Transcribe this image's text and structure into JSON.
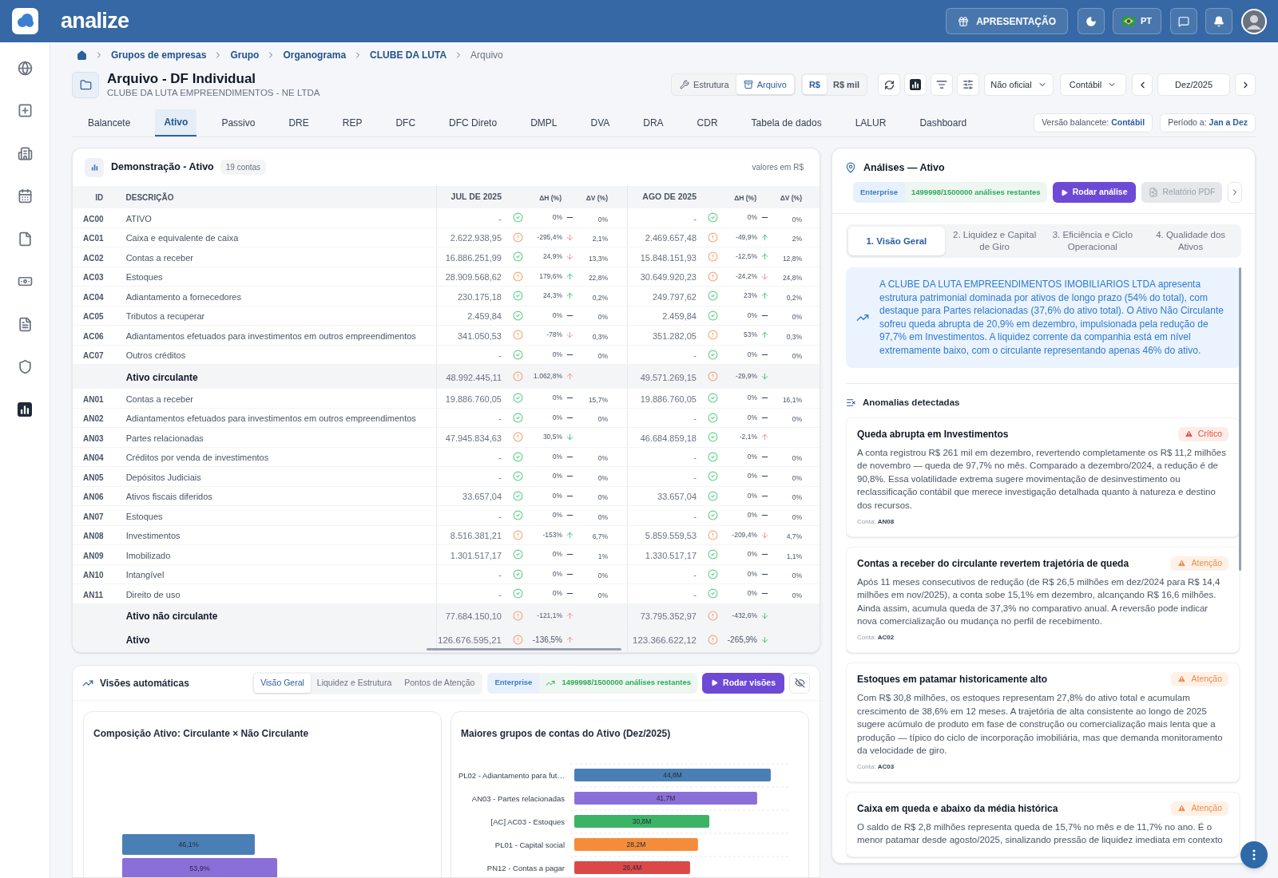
{
  "header": {
    "brand": "analize",
    "presentation_button": "APRESENTAÇÃO",
    "language": "PT"
  },
  "breadcrumb": [
    {
      "label": "Grupos de empresas",
      "current": false
    },
    {
      "label": "Grupo",
      "current": false
    },
    {
      "label": "Organograma",
      "current": false
    },
    {
      "label": "CLUBE DA LUTA",
      "current": false
    },
    {
      "label": "Arquivo",
      "current": true
    }
  ],
  "page": {
    "title": "Arquivo - DF Individual",
    "subtitle": "CLUBE DA LUTA EMPREENDIMENTOS - NE LTDA"
  },
  "toolbar": {
    "view_modes": [
      {
        "label": "Estrutura",
        "selected": false
      },
      {
        "label": "Arquivo",
        "selected": true
      }
    ],
    "units": [
      {
        "label": "R$",
        "selected": true
      },
      {
        "label": "R$ mil",
        "selected": false
      }
    ],
    "status_filter": "Não oficial",
    "basis": "Contábil",
    "period": "Dez/2025"
  },
  "tabs": [
    {
      "label": "Balancete",
      "selected": false
    },
    {
      "label": "Ativo",
      "selected": true
    },
    {
      "label": "Passivo",
      "selected": false
    },
    {
      "label": "DRE",
      "selected": false
    },
    {
      "label": "REP",
      "selected": false
    },
    {
      "label": "DFC",
      "selected": false
    },
    {
      "label": "DFC Direto",
      "selected": false
    },
    {
      "label": "DMPL",
      "selected": false
    },
    {
      "label": "DVA",
      "selected": false
    },
    {
      "label": "DRA",
      "selected": false
    },
    {
      "label": "CDR",
      "selected": false
    },
    {
      "label": "Tabela de dados",
      "selected": false
    },
    {
      "label": "LALUR",
      "selected": false
    },
    {
      "label": "Dashboard",
      "selected": false
    }
  ],
  "chips": [
    "Versão balancete: **Contábil**",
    "Período a: **Jan a Dez**"
  ],
  "statement": {
    "title": "Demonstração - Ativo",
    "count": "19 contas",
    "note": "valores em R$",
    "columns": {
      "id": "ID",
      "description": "DESCRIÇÃO",
      "periods": [
        {
          "label": "JUL DE 2025",
          "change": "ΔH (%)",
          "share": "ΔV (%)"
        },
        {
          "label": "AGO DE 2025",
          "change": "ΔH (%)",
          "share": "ΔV (%)"
        }
      ]
    },
    "rows": [
      {
        "kind": "account",
        "id": "AC00",
        "description": "ATIVO",
        "periods": [
          {
            "value": "-",
            "alert": false,
            "change": "0%",
            "rising": false,
            "falling": false,
            "share": "0%"
          },
          {
            "value": "-",
            "alert": false,
            "change": "0%",
            "rising": false,
            "falling": false,
            "share": "0%"
          }
        ]
      },
      {
        "kind": "account",
        "id": "AC01",
        "description": "Caixa e equivalente de caixa",
        "periods": [
          {
            "value": "2.622.938,95",
            "alert": true,
            "change": "-295,4%",
            "rising": false,
            "falling": true,
            "favorable": false,
            "share": "2,1%"
          },
          {
            "value": "2.469.657,48",
            "alert": true,
            "change": "-49,9%",
            "rising": true,
            "falling": false,
            "favorable": true,
            "share": "2%"
          }
        ]
      },
      {
        "kind": "account",
        "id": "AC02",
        "description": "Contas a receber",
        "periods": [
          {
            "value": "16.886.251,99",
            "alert": false,
            "change": "24,9%",
            "rising": false,
            "falling": true,
            "favorable": false,
            "share": "13,3%"
          },
          {
            "value": "15.848.151,93",
            "alert": true,
            "change": "-12,5%",
            "rising": true,
            "falling": false,
            "favorable": true,
            "share": "12,8%"
          }
        ]
      },
      {
        "kind": "account",
        "id": "AC03",
        "description": "Estoques",
        "periods": [
          {
            "value": "28.909.568,62",
            "alert": true,
            "change": "179,6%",
            "rising": true,
            "falling": false,
            "favorable": true,
            "share": "22,8%"
          },
          {
            "value": "30.649.920,23",
            "alert": true,
            "change": "-24,2%",
            "rising": false,
            "falling": true,
            "favorable": false,
            "share": "24,8%"
          }
        ]
      },
      {
        "kind": "account",
        "id": "AC04",
        "description": "Adiantamento a fornecedores",
        "periods": [
          {
            "value": "230.175,18",
            "alert": false,
            "change": "24,3%",
            "rising": true,
            "falling": false,
            "favorable": true,
            "share": "0,2%"
          },
          {
            "value": "249.797,62",
            "alert": false,
            "change": "23%",
            "rising": true,
            "falling": false,
            "favorable": true,
            "share": "0,2%"
          }
        ]
      },
      {
        "kind": "account",
        "id": "AC05",
        "description": "Tributos a recuperar",
        "periods": [
          {
            "value": "2.459,84",
            "alert": false,
            "change": "0%",
            "rising": false,
            "falling": false,
            "share": "0%"
          },
          {
            "value": "2.459,84",
            "alert": false,
            "change": "0%",
            "rising": false,
            "falling": false,
            "share": "0%"
          }
        ]
      },
      {
        "kind": "account",
        "id": "AC06",
        "description": "Adiantamentos efetuados para investimentos em outros empreendimentos",
        "periods": [
          {
            "value": "341.050,53",
            "alert": true,
            "change": "-78%",
            "rising": false,
            "falling": true,
            "favorable": false,
            "share": "0,3%"
          },
          {
            "value": "351.282,05",
            "alert": true,
            "change": "53%",
            "rising": true,
            "falling": false,
            "favorable": true,
            "share": "0,3%"
          }
        ]
      },
      {
        "kind": "account",
        "id": "AC07",
        "description": "Outros créditos",
        "periods": [
          {
            "value": "-",
            "alert": false,
            "change": "0%",
            "rising": false,
            "falling": false,
            "share": "0%"
          },
          {
            "value": "-",
            "alert": false,
            "change": "0%",
            "rising": false,
            "falling": false,
            "share": "0%"
          }
        ]
      },
      {
        "kind": "subtotal",
        "description": "Ativo circulante",
        "periods": [
          {
            "value": "48.992.445,11",
            "alert": true,
            "change": "1.062,8%",
            "rising": true,
            "falling": false,
            "favorable": false
          },
          {
            "value": "49.571.269,15",
            "alert": true,
            "change": "-29,9%",
            "rising": false,
            "falling": true,
            "favorable": true
          }
        ]
      },
      {
        "kind": "account",
        "id": "AN01",
        "description": "Contas a receber",
        "periods": [
          {
            "value": "19.886.760,05",
            "alert": false,
            "change": "0%",
            "rising": false,
            "falling": false,
            "share": "15,7%"
          },
          {
            "value": "19.886.760,05",
            "alert": false,
            "change": "0%",
            "rising": false,
            "falling": false,
            "share": "16,1%"
          }
        ]
      },
      {
        "kind": "account",
        "id": "AN02",
        "description": "Adiantamentos efetuados para investimentos em outros empreendimentos",
        "periods": [
          {
            "value": "-",
            "alert": false,
            "change": "0%",
            "rising": false,
            "falling": false,
            "share": "0%"
          },
          {
            "value": "-",
            "alert": false,
            "change": "0%",
            "rising": false,
            "falling": false,
            "share": "0%"
          }
        ]
      },
      {
        "kind": "account",
        "id": "AN03",
        "description": "Partes relacionadas",
        "periods": [
          {
            "value": "47.945.834,63",
            "alert": true,
            "change": "30,5%",
            "rising": false,
            "falling": true,
            "favorable": true
          },
          {
            "value": "46.684.859,18",
            "alert": false,
            "change": "-2,1%",
            "rising": true,
            "falling": false,
            "favorable": false
          }
        ]
      },
      {
        "kind": "account",
        "id": "AN04",
        "description": "Créditos por venda de investimentos",
        "periods": [
          {
            "value": "-",
            "alert": false,
            "change": "0%",
            "rising": false,
            "falling": false,
            "share": "0%"
          },
          {
            "value": "-",
            "alert": false,
            "change": "0%",
            "rising": false,
            "falling": false,
            "share": "0%"
          }
        ]
      },
      {
        "kind": "account",
        "id": "AN05",
        "description": "Depósitos Judiciais",
        "periods": [
          {
            "value": "-",
            "alert": false,
            "change": "0%",
            "rising": false,
            "falling": false,
            "share": "0%"
          },
          {
            "value": "-",
            "alert": false,
            "change": "0%",
            "rising": false,
            "falling": false,
            "share": "0%"
          }
        ]
      },
      {
        "kind": "account",
        "id": "AN06",
        "description": "Ativos fiscais diferidos",
        "periods": [
          {
            "value": "33.657,04",
            "alert": false,
            "change": "0%",
            "rising": false,
            "falling": false,
            "share": "0%"
          },
          {
            "value": "33.657,04",
            "alert": false,
            "change": "0%",
            "rising": false,
            "falling": false,
            "share": "0%"
          }
        ]
      },
      {
        "kind": "account",
        "id": "AN07",
        "description": "Estoques",
        "periods": [
          {
            "value": "-",
            "alert": false,
            "change": "0%",
            "rising": false,
            "falling": false,
            "share": "0%"
          },
          {
            "value": "-",
            "alert": false,
            "change": "0%",
            "rising": false,
            "falling": false,
            "share": "0%"
          }
        ]
      },
      {
        "kind": "account",
        "id": "AN08",
        "description": "Investimentos",
        "periods": [
          {
            "value": "8.516.381,21",
            "alert": true,
            "change": "-153%",
            "rising": true,
            "falling": false,
            "favorable": true,
            "share": "6,7%"
          },
          {
            "value": "5.859.559,53",
            "alert": true,
            "change": "-209,4%",
            "rising": false,
            "falling": true,
            "favorable": false,
            "share": "4,7%"
          }
        ]
      },
      {
        "kind": "account",
        "id": "AN09",
        "description": "Imobilizado",
        "periods": [
          {
            "value": "1.301.517,17",
            "alert": false,
            "change": "0%",
            "rising": false,
            "falling": false,
            "share": "1%"
          },
          {
            "value": "1.330.517,17",
            "alert": false,
            "change": "0%",
            "rising": false,
            "falling": false,
            "share": "1,1%"
          }
        ]
      },
      {
        "kind": "account",
        "id": "AN10",
        "description": "Intangível",
        "periods": [
          {
            "value": "-",
            "alert": false,
            "change": "0%",
            "rising": false,
            "falling": false,
            "share": "0%"
          },
          {
            "value": "-",
            "alert": false,
            "change": "0%",
            "rising": false,
            "falling": false,
            "share": "0%"
          }
        ]
      },
      {
        "kind": "account",
        "id": "AN11",
        "description": "Direito de uso",
        "periods": [
          {
            "value": "-",
            "alert": false,
            "change": "0%",
            "rising": false,
            "falling": false,
            "share": "0%"
          },
          {
            "value": "-",
            "alert": false,
            "change": "0%",
            "rising": false,
            "falling": false,
            "share": "0%"
          }
        ]
      },
      {
        "kind": "subtotal",
        "description": "Ativo não circulante",
        "periods": [
          {
            "value": "77.684.150,10",
            "alert": true,
            "change": "-121,1%",
            "rising": true,
            "falling": false,
            "favorable": false
          },
          {
            "value": "73.795.352,97",
            "alert": true,
            "change": "-432,6%",
            "rising": false,
            "falling": true,
            "favorable": true
          }
        ]
      },
      {
        "kind": "total",
        "description": "Ativo",
        "periods": [
          {
            "value": "126.676.595,21",
            "alert": true,
            "change": "-136,5%",
            "rising": true,
            "falling": false,
            "favorable": false
          },
          {
            "value": "123.366.622,12",
            "alert": true,
            "change": "-265,9%",
            "rising": false,
            "falling": true,
            "favorable": true
          }
        ]
      }
    ]
  },
  "auto_views": {
    "title": "Visões automáticas",
    "tabs": [
      {
        "label": "Visão Geral",
        "selected": true
      },
      {
        "label": "Liquidez e Estrutura",
        "selected": false
      },
      {
        "label": "Pontos de Atenção",
        "selected": false
      }
    ],
    "plan": "Enterprise",
    "quota": "1499998/1500000 análises restantes",
    "run_button": "Rodar visões",
    "charts": [
      {
        "title": "Composição Ativo: Circulante × Não Circulante",
        "chart_data": {
          "type": "bar",
          "orientation": "horizontal",
          "values": [
            46.1,
            53.9
          ],
          "value_labels": [
            "46,1%",
            "53,9%"
          ],
          "colors": [
            "#4a7fb5",
            "#8b6fd8"
          ]
        }
      },
      {
        "title": "Maiores grupos de contas do Ativo (Dez/2025)",
        "chart_data": {
          "type": "bar",
          "orientation": "horizontal",
          "categories": [
            "PL02 - Adiantamento para fut…",
            "AN03 - Partes relacionadas",
            "[AC] AC03 - Estoques",
            "PL01 - Capital social",
            "PN12 - Contas a pagar"
          ],
          "values": [
            44.8,
            41.7,
            30.8,
            28.2,
            26.4
          ],
          "value_labels": [
            "44,8M",
            "41,7M",
            "30,8M",
            "28,2M",
            "26,4M"
          ],
          "colors": [
            "#4a7fb5",
            "#8b6fd8",
            "#3cb465",
            "#f48c3a",
            "#dc4848"
          ]
        }
      }
    ]
  },
  "analyses": {
    "title": "Análises — Ativo",
    "plan": "Enterprise",
    "quota": "1499998/1500000 análises restantes",
    "run_button": "Rodar análise",
    "pdf_button": {
      "label": "Relatório PDF",
      "disabled": true
    },
    "tabs": [
      {
        "label": "1. Visão Geral",
        "selected": true
      },
      {
        "label": "2. Liquidez e Capital de Giro",
        "selected": false
      },
      {
        "label": "3. Eficiência e Ciclo Operacional",
        "selected": false
      },
      {
        "label": "4. Qualidade dos Ativos",
        "selected": false
      }
    ],
    "summary": "A CLUBE DA LUTA EMPREENDIMENTOS IMOBILIARIOS LTDA apresenta estrutura patrimonial dominada por ativos de longo prazo (54% do total), com destaque para Partes relacionadas (37,6% do ativo total). O Ativo Não Circulante sofreu queda abrupta de 20,9% em dezembro, impulsionada pela redução de 97,7% em Investimentos. A liquidez corrente da companhia está em nível extremamente baixo, com o circulante representando apenas 46% do ativo.",
    "anomalies_title": "Anomalias detectadas",
    "anomalies": [
      {
        "title": "Queda abrupta em Investimentos",
        "critical": true,
        "severity_label": "Crítico",
        "text": "A conta registrou R$ 261 mil em dezembro, revertendo completamente os R$ 11,2 milhões de novembro — queda de 97,7% no mês. Comparado a dezembro/2024, a redução é de 90,8%. Essa volatilidade extrema sugere movimentação de desinvestimento ou reclassificação contábil que merece investigação detalhada quanto à natureza e destino dos recursos.",
        "account": "Conta: **AN08**"
      },
      {
        "title": "Contas a receber do circulante revertem trajetória de queda",
        "critical": false,
        "severity_label": "Atenção",
        "text": "Após 11 meses consecutivos de redução (de R$ 26,5 milhões em dez/2024 para R$ 14,4 milhões em nov/2025), a conta sobe 15,1% em dezembro, alcançando R$ 16,6 milhões. Ainda assim, acumula queda de 37,3% no comparativo anual. A reversão pode indicar nova comercialização ou mudança no perfil de recebimento.",
        "account": "Conta: **AC02**"
      },
      {
        "title": "Estoques em patamar historicamente alto",
        "critical": false,
        "severity_label": "Atenção",
        "text": "Com R$ 30,8 milhões, os estoques representam 27,8% do ativo total e acumulam crescimento de 38,6% em 12 meses. A trajetória de alta consistente ao longo de 2025 sugere acúmulo de produto em fase de construção ou comercialização mais lenta que a produção — típico do ciclo de incorporação imobiliária, mas que demanda monitoramento da velocidade de giro.",
        "account": "Conta: **AC03**"
      },
      {
        "title": "Caixa em queda e abaixo da média histórica",
        "critical": false,
        "severity_label": "Atenção",
        "text": "O saldo de R$ 2,8 milhões representa queda de 15,7% no mês e de 11,7% no ano. É o menor patamar desde agosto/2025, sinalizando pressão de liquidez imediata em contexto"
      }
    ]
  }
}
